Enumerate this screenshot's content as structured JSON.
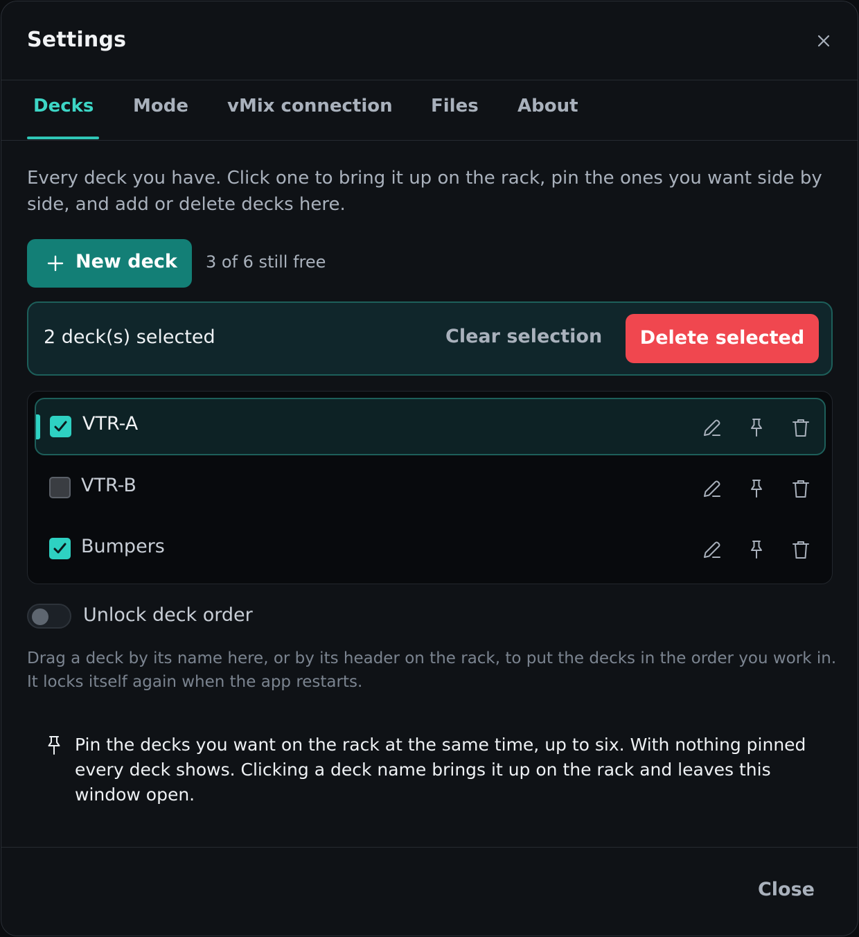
{
  "dialog": {
    "title": "Settings",
    "close_icon": "close-icon"
  },
  "tabs": [
    {
      "label": "Decks",
      "active": true
    },
    {
      "label": "Mode",
      "active": false
    },
    {
      "label": "vMix connection",
      "active": false
    },
    {
      "label": "Files",
      "active": false
    },
    {
      "label": "About",
      "active": false
    }
  ],
  "decks_panel": {
    "intro": "Every deck you have. Click one to bring it up on the rack, pin the ones you want side by side, and add or delete decks here.",
    "new_deck_label": "New deck",
    "free_count": "3 of 6 still free",
    "selection": {
      "count_text": "2 deck(s) selected",
      "clear_label": "Clear selection",
      "delete_label": "Delete selected"
    },
    "decks": [
      {
        "name": "VTR-A",
        "checked": true,
        "active": true
      },
      {
        "name": "VTR-B",
        "checked": false,
        "active": false
      },
      {
        "name": "Bumpers",
        "checked": true,
        "active": false
      }
    ],
    "row_icons": [
      "edit-icon",
      "pin-icon",
      "trash-icon"
    ],
    "unlock_order": {
      "label": "Unlock deck order",
      "enabled": false,
      "help": "Drag a deck by its name here, or by its header on the rack, to put the decks in the order you work in. It locks itself again when the app restarts."
    },
    "pin_info": "Pin the decks you want on the rack at the same time, up to six. With nothing pinned every deck shows. Clicking a deck name brings it up on the rack and leaves this window open."
  },
  "footer": {
    "close_label": "Close"
  },
  "colors": {
    "accent": "#2fd3c4",
    "primary_button": "#137f76",
    "danger": "#f0474f",
    "background": "#0f1216"
  }
}
